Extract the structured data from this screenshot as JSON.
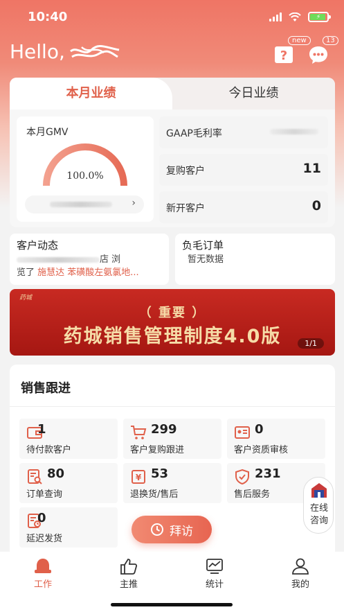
{
  "status_bar": {
    "time": "10:40"
  },
  "header": {
    "greeting": "Hello,",
    "help_badge": "new",
    "message_badge": "13"
  },
  "performance": {
    "tabs": [
      {
        "label": "本月业绩",
        "active": true
      },
      {
        "label": "今日业绩",
        "active": false
      }
    ],
    "gmv": {
      "label": "本月GMV",
      "percent": "100.0%",
      "progress": 1.0
    },
    "metrics": [
      {
        "label": "GAAP毛利率",
        "value": ""
      },
      {
        "label": "复购客户",
        "value": "11"
      },
      {
        "label": "新开客户",
        "value": "0"
      }
    ]
  },
  "customer_activity": {
    "title": "客户动态",
    "line1_suffix": "店 浏",
    "line2_prefix": "览了 ",
    "line2_highlight": "施慧达 苯磺酸左氨氯地..."
  },
  "negative_orders": {
    "title": "负毛订单",
    "empty_text": "暂无数据"
  },
  "banner": {
    "logo": "药城",
    "subtitle": "（    重要    ）",
    "title": "药城销售管理制度4.0版",
    "page": "1/1"
  },
  "sales": {
    "title": "销售跟进",
    "items": [
      {
        "count": "1",
        "label": "待付款客户",
        "icon": "wallet-icon"
      },
      {
        "count": "299",
        "label": "客户复购跟进",
        "icon": "cart-icon"
      },
      {
        "count": "0",
        "label": "客户资质审核",
        "icon": "id-card-icon"
      },
      {
        "count": "80",
        "label": "订单查询",
        "icon": "order-search-icon"
      },
      {
        "count": "53",
        "label": "退换货/售后",
        "icon": "refund-icon"
      },
      {
        "count": "231",
        "label": "售后服务",
        "icon": "shield-check-icon"
      },
      {
        "count": "0",
        "label": "延迟发货",
        "icon": "delay-icon"
      }
    ]
  },
  "visit_button": {
    "label": "拜访",
    "icon": "clock-icon"
  },
  "online_consult": {
    "line1": "在线",
    "line2": "咨询"
  },
  "tabbar": [
    {
      "label": "工作",
      "icon": "bell-icon",
      "active": true
    },
    {
      "label": "主推",
      "icon": "thumbs-up-icon",
      "active": false
    },
    {
      "label": "统计",
      "icon": "chart-icon",
      "active": false
    },
    {
      "label": "我的",
      "icon": "person-icon",
      "active": false
    }
  ],
  "colors": {
    "accent": "#e0604a",
    "header_top": "#ef7565",
    "banner_red": "#b8201a",
    "banner_gold": "#f6dca8"
  }
}
